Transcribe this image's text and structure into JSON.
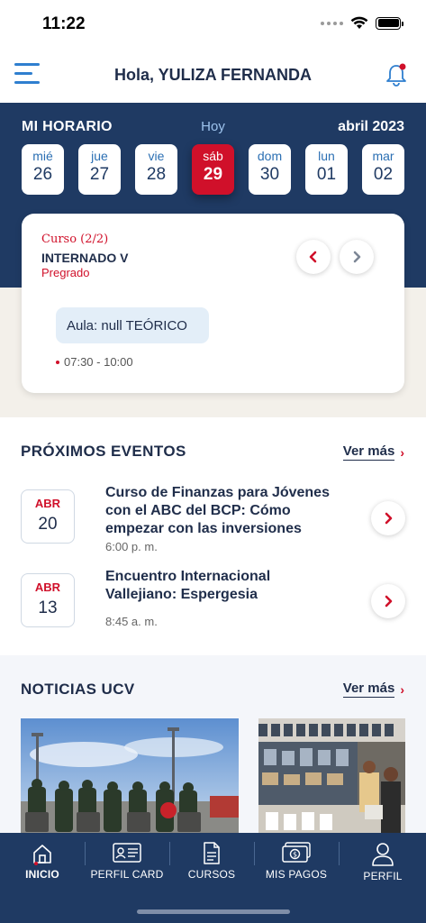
{
  "status_bar": {
    "time": "11:22"
  },
  "header": {
    "greeting": "Hola, YULIZA FERNANDA"
  },
  "schedule": {
    "title": "MI HORARIO",
    "today_label": "Hoy",
    "month_label": "abril 2023",
    "days": [
      {
        "name": "mié",
        "num": "26"
      },
      {
        "name": "jue",
        "num": "27"
      },
      {
        "name": "vie",
        "num": "28"
      },
      {
        "name": "sáb",
        "num": "29"
      },
      {
        "name": "dom",
        "num": "30"
      },
      {
        "name": "lun",
        "num": "01"
      },
      {
        "name": "mar",
        "num": "02"
      }
    ],
    "selected_index": 3
  },
  "class_card": {
    "course_count": "Curso (2/2)",
    "course_name": "INTERNADO V",
    "level": "Pregrado",
    "room": "Aula: null TEÓRICO",
    "time": "07:30 - 10:00"
  },
  "events": {
    "title": "PRÓXIMOS EVENTOS",
    "see_more": "Ver más",
    "items": [
      {
        "month": "ABR",
        "day": "20",
        "title": "Curso de Finanzas para Jóvenes con el ABC del BCP: Cómo empezar con las inversiones",
        "time": "6:00 p. m."
      },
      {
        "month": "ABR",
        "day": "13",
        "title": "Encuentro Internacional Vallejiano: Espergesia",
        "time": "8:45 a. m."
      }
    ]
  },
  "news": {
    "title": "NOTICIAS UCV",
    "see_more": "Ver más"
  },
  "tabbar": {
    "items": [
      {
        "label": "INICIO",
        "icon": "home-icon"
      },
      {
        "label": "PERFIL CARD",
        "icon": "id-card-icon"
      },
      {
        "label": "CURSOS",
        "icon": "document-icon"
      },
      {
        "label": "MIS PAGOS",
        "icon": "money-icon"
      },
      {
        "label": "PERFIL",
        "icon": "user-icon"
      }
    ],
    "active_index": 0
  },
  "colors": {
    "navy": "#1f3a63",
    "accent_red": "#d0102a",
    "light_blue": "#e3eef8",
    "beige": "#f3f0ea"
  }
}
